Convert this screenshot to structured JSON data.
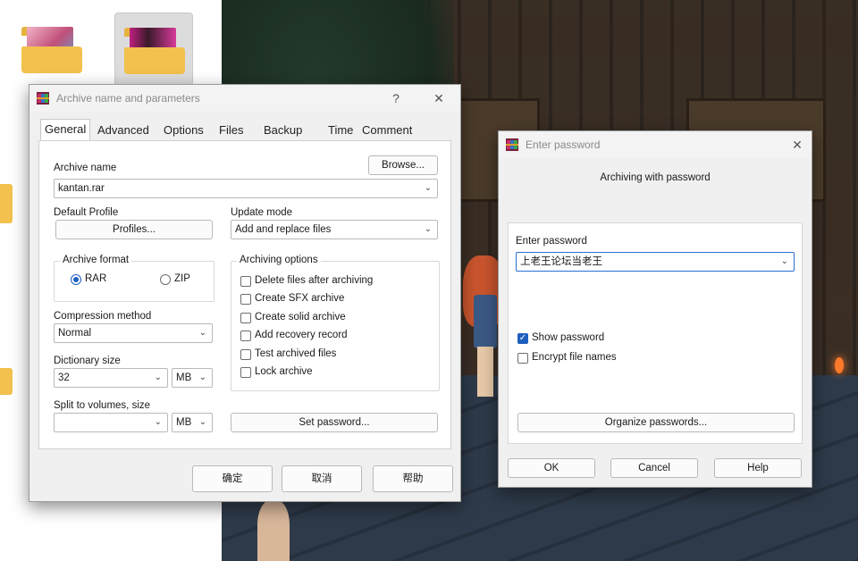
{
  "explorer": {
    "folders": [
      "folder-1",
      "folder-2"
    ]
  },
  "archive_dialog": {
    "title": "Archive name and parameters",
    "help_glyph": "?",
    "close_glyph": "✕",
    "tabs": [
      "General",
      "Advanced",
      "Options",
      "Files",
      "Backup",
      "Time",
      "Comment"
    ],
    "active_tab": "General",
    "archive_name_label": "Archive name",
    "browse_label": "Browse...",
    "archive_name_value": "kantan.rar",
    "default_profile_label": "Default Profile",
    "profiles_label": "Profiles...",
    "update_mode_label": "Update mode",
    "update_mode_value": "Add and replace files",
    "archive_format_label": "Archive format",
    "format_rar": "RAR",
    "format_zip": "ZIP",
    "selected_format": "RAR",
    "compression_label": "Compression method",
    "compression_value": "Normal",
    "dictionary_label": "Dictionary size",
    "dictionary_value": "32",
    "dictionary_unit": "MB",
    "split_label": "Split to volumes, size",
    "split_value": "",
    "split_unit": "MB",
    "archiving_options_label": "Archiving options",
    "options": [
      {
        "label": "Delete files after archiving",
        "checked": false
      },
      {
        "label": "Create SFX archive",
        "checked": false
      },
      {
        "label": "Create solid archive",
        "checked": false
      },
      {
        "label": "Add recovery record",
        "checked": false
      },
      {
        "label": "Test archived files",
        "checked": false
      },
      {
        "label": "Lock archive",
        "checked": false
      }
    ],
    "set_password_label": "Set password...",
    "ok_label": "确定",
    "cancel_label": "取消",
    "help_label": "帮助"
  },
  "password_dialog": {
    "title": "Enter password",
    "close_glyph": "✕",
    "heading": "Archiving with password",
    "enter_password_label": "Enter password",
    "password_value": "上老王论坛当老王",
    "show_password_label": "Show password",
    "show_password_checked": true,
    "encrypt_names_label": "Encrypt file names",
    "encrypt_names_checked": false,
    "organize_label": "Organize passwords...",
    "ok_label": "OK",
    "cancel_label": "Cancel",
    "help_label": "Help"
  },
  "colors": {
    "accent": "#1d5fbf",
    "dialog_bg": "#f0f0f0",
    "panel_bg": "#ffffff"
  }
}
